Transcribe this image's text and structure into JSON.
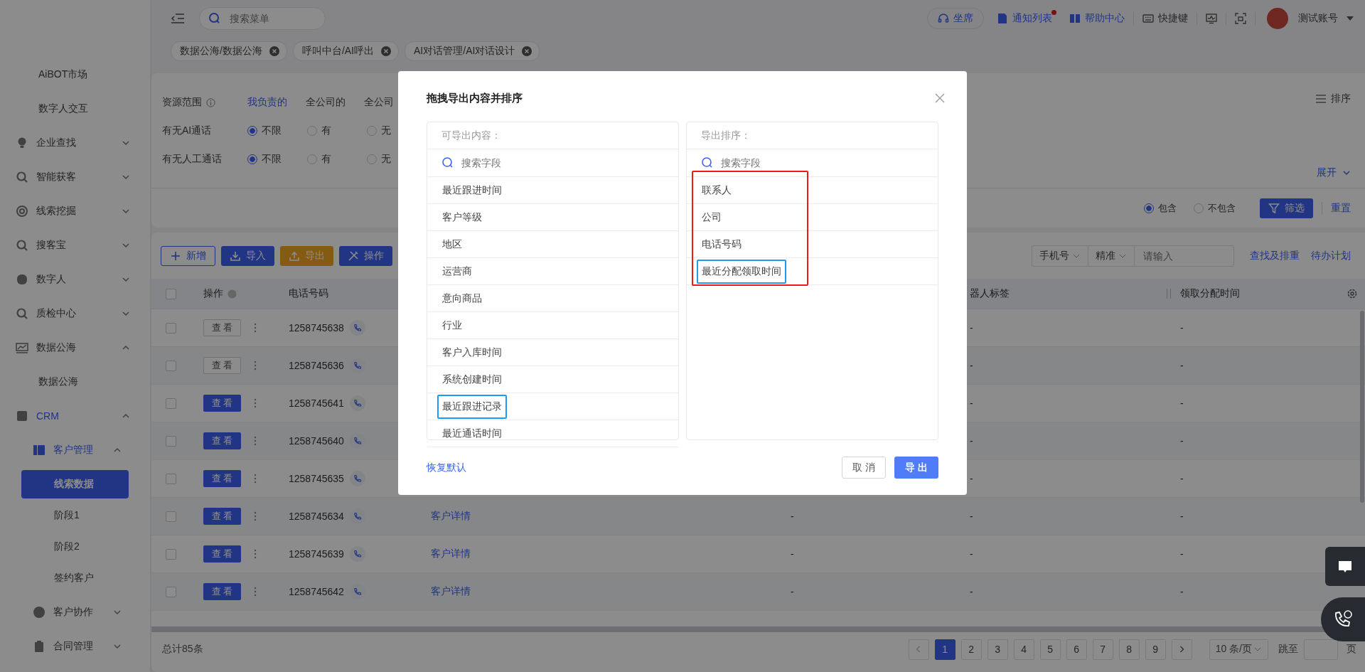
{
  "sidebar": {
    "items": [
      {
        "label": "AiBOT市场",
        "selected": false
      },
      {
        "label": "数字人交互",
        "selected": false
      },
      {
        "label": "企业查找",
        "expanded": false
      },
      {
        "label": "智能获客",
        "expanded": false
      },
      {
        "label": "线索挖掘",
        "expanded": false
      },
      {
        "label": "搜客宝",
        "expanded": false
      },
      {
        "label": "数字人",
        "expanded": false
      },
      {
        "label": "质检中心",
        "expanded": false
      },
      {
        "label": "数据公海",
        "expanded": true,
        "children": [
          {
            "label": "数据公海",
            "selected": false
          }
        ]
      },
      {
        "label": "CRM",
        "expanded": true,
        "children": [
          {
            "label": "客户管理",
            "expanded": true,
            "children": [
              {
                "label": "线索数据",
                "selected": true
              },
              {
                "label": "阶段1",
                "selected": false
              },
              {
                "label": "阶段2",
                "selected": false
              },
              {
                "label": "签约客户",
                "selected": false
              }
            ]
          },
          {
            "label": "客户协作",
            "expanded": false
          },
          {
            "label": "合同管理",
            "expanded": false
          }
        ]
      }
    ]
  },
  "header": {
    "search_placeholder": "搜索菜单",
    "tabs": [
      {
        "label": "数据公海/数据公海"
      },
      {
        "label": "呼叫中台/AI呼出"
      },
      {
        "label": "AI对话管理/AI对话设计"
      }
    ],
    "actions": [
      {
        "kind": "seat",
        "label": "坐席"
      },
      {
        "kind": "notice",
        "label": "通知列表",
        "unread": true
      },
      {
        "kind": "help",
        "label": "帮助中心"
      },
      {
        "kind": "shortcut",
        "label": "快捷键"
      },
      {
        "kind": "monitor"
      },
      {
        "kind": "capture"
      }
    ],
    "user": {
      "name": "测试账号"
    }
  },
  "filter": {
    "rows": [
      {
        "label": "资源范围",
        "info": true,
        "kind": "links",
        "options": [
          {
            "label": "我负责的",
            "selected": true
          },
          {
            "label": "全公司的",
            "selected": false
          },
          {
            "label": "全公司",
            "selected": false
          }
        ]
      },
      {
        "label": "有无AI通话",
        "kind": "radio",
        "options": [
          {
            "label": "不限",
            "selected": true
          },
          {
            "label": "有",
            "selected": false
          },
          {
            "label": "无",
            "selected": false
          }
        ]
      },
      {
        "label": "有无人工通话",
        "kind": "radio",
        "options": [
          {
            "label": "不限",
            "selected": true
          },
          {
            "label": "有",
            "selected": false
          },
          {
            "label": "无",
            "selected": false
          }
        ]
      }
    ],
    "sort_label": "排序",
    "expand_label": "展开",
    "match_options": [
      {
        "label": "包含",
        "selected": true
      },
      {
        "label": "不包含",
        "selected": false
      }
    ],
    "filter_button": "筛选",
    "reset_link": "重置"
  },
  "toolbar": {
    "buttons": [
      {
        "kind": "add",
        "label": "新增"
      },
      {
        "kind": "import",
        "label": "导入"
      },
      {
        "kind": "export",
        "label": "导出"
      },
      {
        "kind": "batch",
        "label": "操作"
      }
    ],
    "field_select": "手机号",
    "mode_select": "精准",
    "input_placeholder": "请输入",
    "links": [
      "查找及排重",
      "待办计划"
    ]
  },
  "table": {
    "all_checked": false,
    "headers": {
      "operation": "操作",
      "phone": "电话号码",
      "column_6": "器人标签",
      "assign_time": "领取分配时间"
    },
    "rows": [
      {
        "checked": false,
        "view": "查 看",
        "filled": false,
        "phone": "1258745638",
        "column_6": "-",
        "assign_time": "-"
      },
      {
        "checked": false,
        "view": "查 看",
        "filled": false,
        "phone": "1258745636",
        "column_6": "-",
        "assign_time": "-"
      },
      {
        "checked": false,
        "view": "查 看",
        "filled": true,
        "phone": "1258745641",
        "column_6": "-",
        "assign_time": "-"
      },
      {
        "checked": false,
        "view": "查 看",
        "filled": true,
        "phone": "1258745640",
        "column_6": "-",
        "assign_time": "-"
      },
      {
        "checked": false,
        "view": "查 看",
        "filled": true,
        "phone": "1258745635",
        "column_6": "-",
        "assign_time": "-"
      },
      {
        "checked": false,
        "view": "查 看",
        "filled": true,
        "phone": "1258745634",
        "column_4": "客户详情",
        "column_5": "-",
        "column_6": "-",
        "assign_time": "-"
      },
      {
        "checked": false,
        "view": "查 看",
        "filled": true,
        "phone": "1258745639",
        "column_4": "客户详情",
        "column_5": "-",
        "column_6": "-",
        "assign_time": "-"
      },
      {
        "checked": false,
        "view": "查 看",
        "filled": true,
        "phone": "1258745642",
        "column_4": "客户详情",
        "column_5": "-",
        "column_6": "-",
        "assign_time": "-"
      }
    ]
  },
  "pagination": {
    "total": "总计85条",
    "pages": [
      {
        "label": "1",
        "selected": true
      },
      {
        "label": "2",
        "selected": false
      },
      {
        "label": "3",
        "selected": false
      },
      {
        "label": "4",
        "selected": false
      },
      {
        "label": "5",
        "selected": false
      },
      {
        "label": "6",
        "selected": false
      },
      {
        "label": "7",
        "selected": false
      },
      {
        "label": "8",
        "selected": false
      },
      {
        "label": "9",
        "selected": false
      }
    ],
    "page_size": "10 条/页",
    "jump_label": "跳至",
    "page_unit": "页"
  },
  "modal": {
    "title": "拖拽导出内容并排序",
    "available": {
      "heading": "可导出内容：",
      "search_placeholder": "搜索字段",
      "items": [
        {
          "label": "最近跟进时间",
          "highlighted": false
        },
        {
          "label": "客户等级",
          "highlighted": false
        },
        {
          "label": "地区",
          "highlighted": false
        },
        {
          "label": "运营商",
          "highlighted": false
        },
        {
          "label": "意向商品",
          "highlighted": false
        },
        {
          "label": "行业",
          "highlighted": false
        },
        {
          "label": "客户入库时间",
          "highlighted": false
        },
        {
          "label": "系统创建时间",
          "highlighted": false
        },
        {
          "label": "最近跟进记录",
          "highlighted": true
        },
        {
          "label": "最近通话时间",
          "highlighted": false
        }
      ]
    },
    "order": {
      "heading": "导出排序：",
      "search_placeholder": "搜索字段",
      "framed": true,
      "items": [
        {
          "label": "联系人",
          "highlighted": false
        },
        {
          "label": "公司",
          "highlighted": false
        },
        {
          "label": "电话号码",
          "highlighted": false
        },
        {
          "label": "最近分配领取时间",
          "highlighted": true
        }
      ]
    },
    "restore_link": "恢复默认",
    "cancel": "取 消",
    "confirm": "导 出"
  }
}
